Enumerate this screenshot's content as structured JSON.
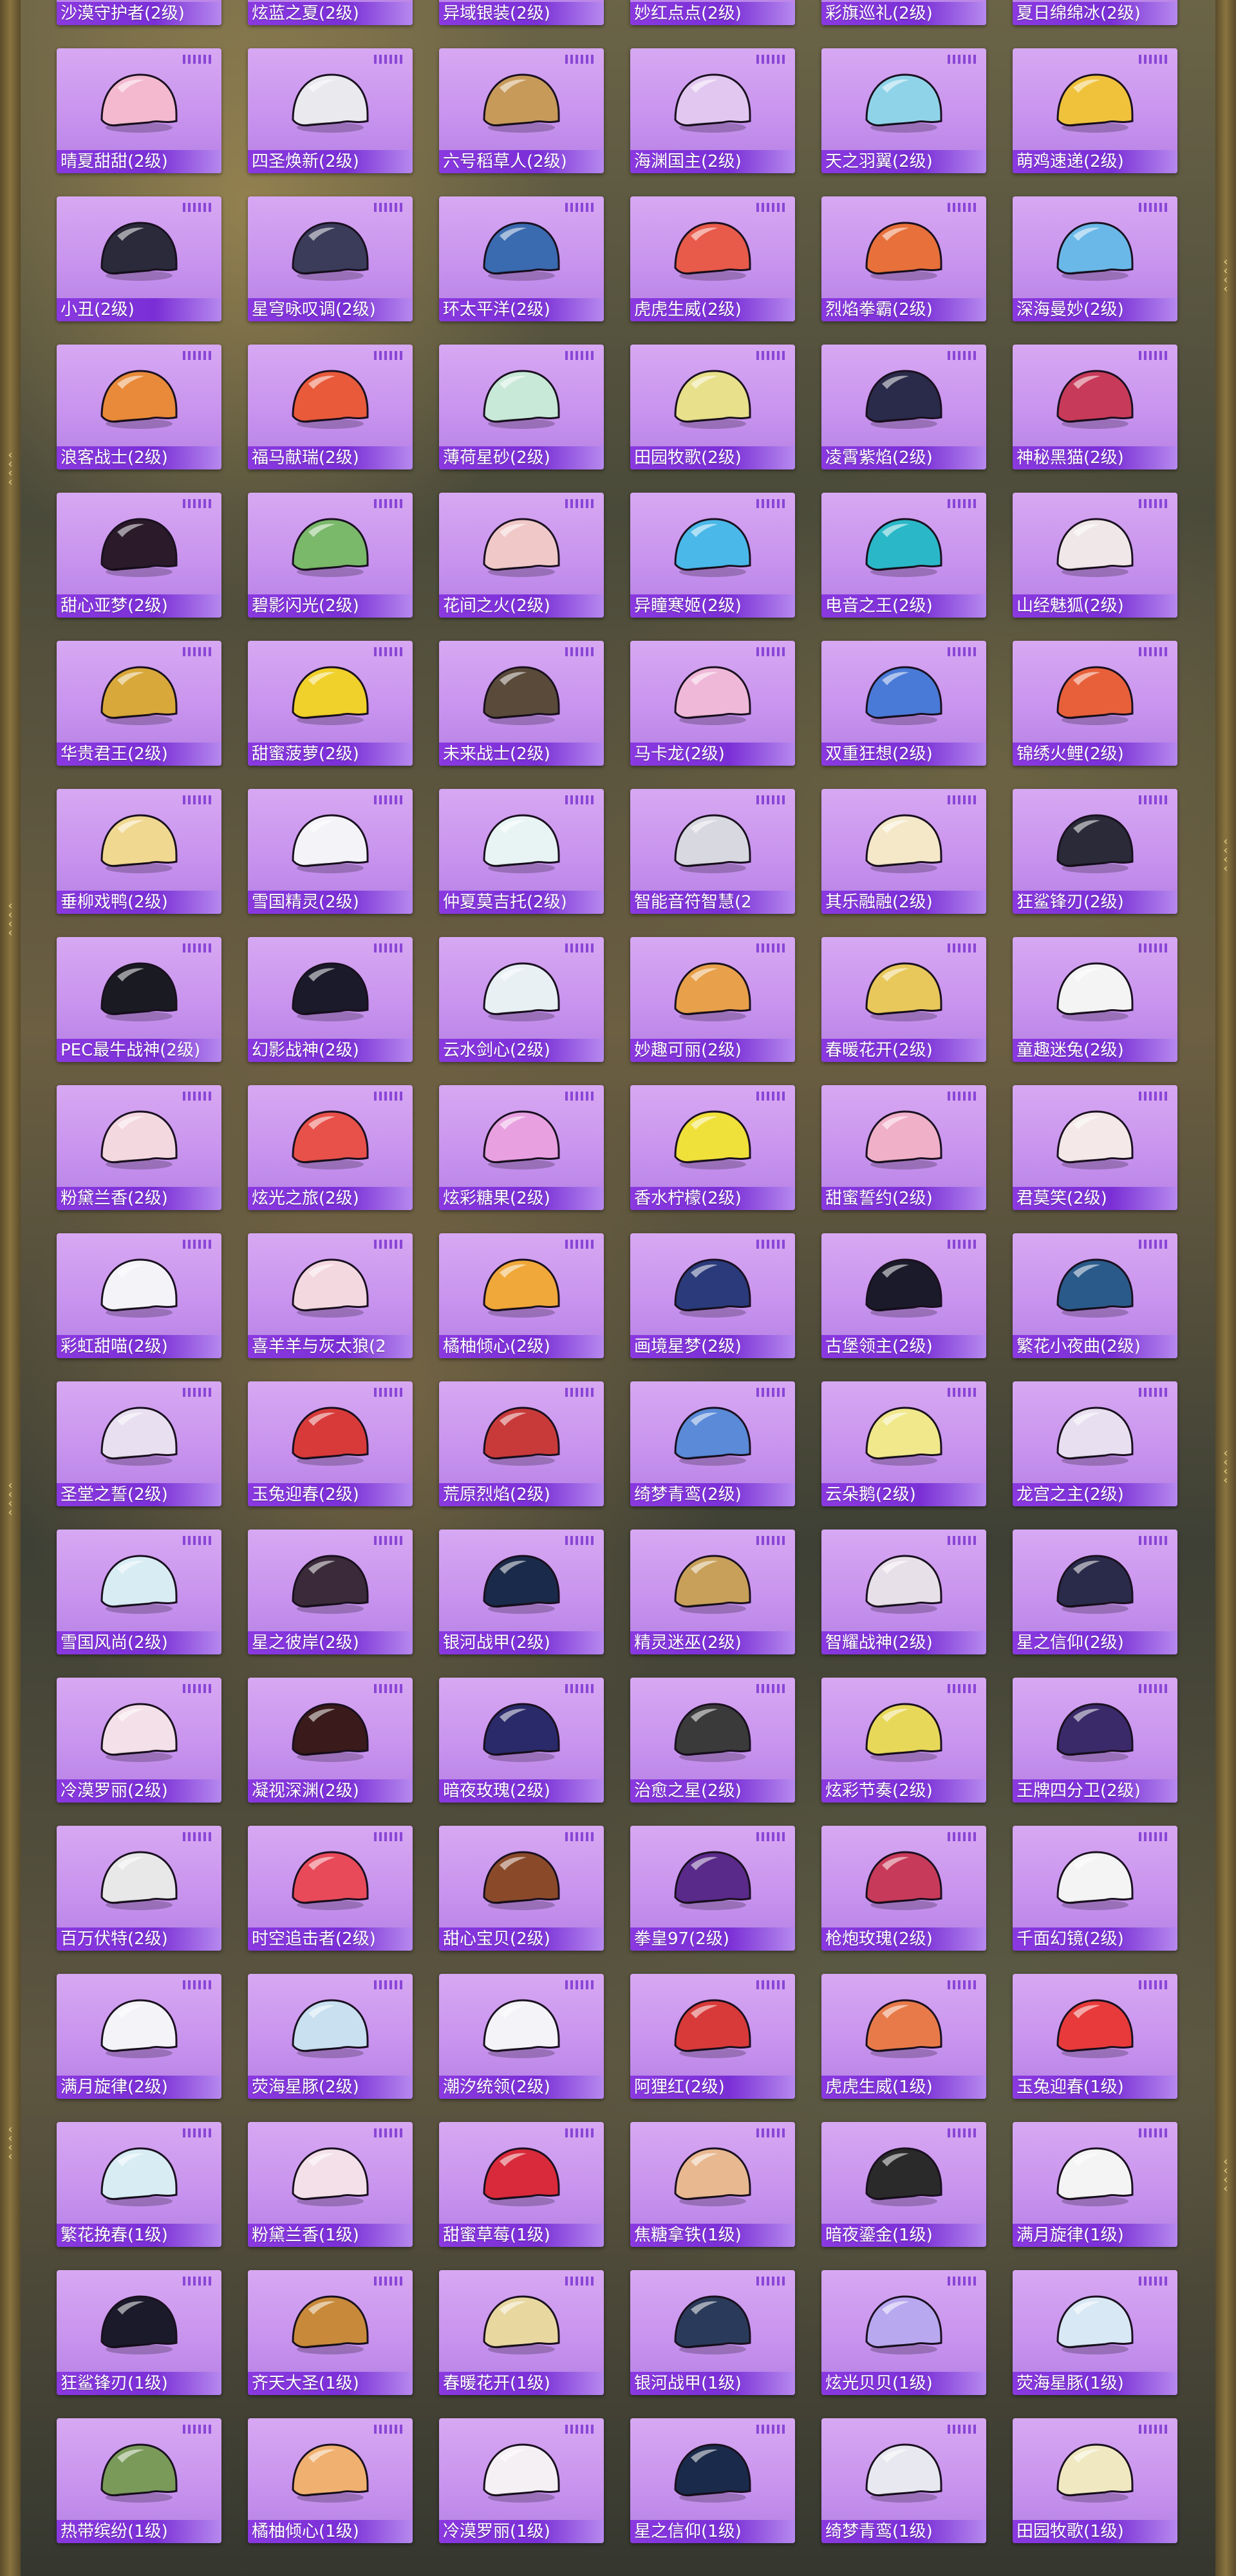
{
  "cards": [
    {
      "label": "沙漠守护者(2级)",
      "color": "#c8a36a",
      "icon": "helmet-icon"
    },
    {
      "label": "炫蓝之夏(2级)",
      "color": "#4a7bd8",
      "icon": "helmet-icon"
    },
    {
      "label": "异域银装(2级)",
      "color": "#c9c9d6",
      "icon": "helmet-icon"
    },
    {
      "label": "妙红点点(2级)",
      "color": "#d84a4a",
      "icon": "helmet-icon"
    },
    {
      "label": "彩旗巡礼(2级)",
      "color": "#e8a64a",
      "icon": "helmet-icon"
    },
    {
      "label": "夏日绵绵冰(2级)",
      "color": "#f2c6e6",
      "icon": "helmet-icon"
    },
    {
      "label": "晴夏甜甜(2级)",
      "color": "#f4b9cf",
      "icon": "helmet-icon"
    },
    {
      "label": "四圣焕新(2级)",
      "color": "#e9e9ee",
      "icon": "helmet-icon"
    },
    {
      "label": "六号稻草人(2级)",
      "color": "#c79a5a",
      "icon": "helmet-icon"
    },
    {
      "label": "海渊国主(2级)",
      "color": "#e2c8f0",
      "icon": "helmet-icon"
    },
    {
      "label": "天之羽翼(2级)",
      "color": "#8fd3e8",
      "icon": "helmet-icon"
    },
    {
      "label": "萌鸡速递(2级)",
      "color": "#f0c23c",
      "icon": "helmet-icon"
    },
    {
      "label": "小丑(2级)",
      "color": "#2a2a3a",
      "icon": "helmet-icon"
    },
    {
      "label": "星穹咏叹调(2级)",
      "color": "#3b3b5a",
      "icon": "helmet-icon"
    },
    {
      "label": "环太平洋(2级)",
      "color": "#3a6ab0",
      "icon": "helmet-icon"
    },
    {
      "label": "虎虎生威(2级)",
      "color": "#e85a4a",
      "icon": "helmet-icon"
    },
    {
      "label": "烈焰拳霸(2级)",
      "color": "#e8703a",
      "icon": "helmet-icon"
    },
    {
      "label": "深海曼妙(2级)",
      "color": "#6ab8e8",
      "icon": "helmet-icon"
    },
    {
      "label": "浪客战士(2级)",
      "color": "#e88a3a",
      "icon": "helmet-icon"
    },
    {
      "label": "福马献瑞(2级)",
      "color": "#e85a3a",
      "icon": "helmet-icon"
    },
    {
      "label": "薄荷星砂(2级)",
      "color": "#c8e8d8",
      "icon": "helmet-icon"
    },
    {
      "label": "田园牧歌(2级)",
      "color": "#e8e08a",
      "icon": "helmet-icon"
    },
    {
      "label": "凌霄紫焰(2级)",
      "color": "#2a2a4a",
      "icon": "helmet-icon"
    },
    {
      "label": "神秘黑猫(2级)",
      "color": "#c83a5a",
      "icon": "helmet-icon"
    },
    {
      "label": "甜心亚梦(2级)",
      "color": "#2a1a2a",
      "icon": "helmet-icon"
    },
    {
      "label": "碧影闪光(2级)",
      "color": "#7ab86a",
      "icon": "helmet-icon"
    },
    {
      "label": "花间之火(2级)",
      "color": "#f0c8c8",
      "icon": "helmet-icon"
    },
    {
      "label": "异瞳寒姬(2级)",
      "color": "#4ab8e8",
      "icon": "helmet-icon"
    },
    {
      "label": "电音之王(2级)",
      "color": "#2ab8c8",
      "icon": "helmet-icon"
    },
    {
      "label": "山经魅狐(2级)",
      "color": "#f0e8e8",
      "icon": "helmet-icon"
    },
    {
      "label": "华贵君王(2级)",
      "color": "#d8a83a",
      "icon": "helmet-icon"
    },
    {
      "label": "甜蜜菠萝(2级)",
      "color": "#f0d02a",
      "icon": "helmet-icon"
    },
    {
      "label": "未来战士(2级)",
      "color": "#5a4a3a",
      "icon": "helmet-icon"
    },
    {
      "label": "马卡龙(2级)",
      "color": "#f0b8d8",
      "icon": "helmet-icon"
    },
    {
      "label": "双重狂想(2级)",
      "color": "#4a7ad8",
      "icon": "helmet-icon"
    },
    {
      "label": "锦绣火鲤(2级)",
      "color": "#e8603a",
      "icon": "helmet-icon"
    },
    {
      "label": "垂柳戏鸭(2级)",
      "color": "#f0d890",
      "icon": "helmet-icon"
    },
    {
      "label": "雪国精灵(2级)",
      "color": "#f4f4f8",
      "icon": "helmet-icon"
    },
    {
      "label": "仲夏莫吉托(2级)",
      "color": "#e8f4f4",
      "icon": "helmet-icon"
    },
    {
      "label": "智能音符智慧(2",
      "color": "#d8d8e0",
      "icon": "helmet-icon"
    },
    {
      "label": "其乐融融(2级)",
      "color": "#f4e8c8",
      "icon": "helmet-icon"
    },
    {
      "label": "狂鲨锋刃(2级)",
      "color": "#2a2a38",
      "icon": "helmet-icon"
    },
    {
      "label": "PEC最牛战神(2级)",
      "color": "#1a1a22",
      "icon": "helmet-icon"
    },
    {
      "label": "幻影战神(2级)",
      "color": "#1a1a2a",
      "icon": "helmet-icon"
    },
    {
      "label": "云水剑心(2级)",
      "color": "#e8f0f4",
      "icon": "helmet-icon"
    },
    {
      "label": "妙趣可丽(2级)",
      "color": "#e8a04a",
      "icon": "helmet-icon"
    },
    {
      "label": "春暖花开(2级)",
      "color": "#e8c85a",
      "icon": "helmet-icon"
    },
    {
      "label": "童趣迷兔(2级)",
      "color": "#f4f4f4",
      "icon": "helmet-icon"
    },
    {
      "label": "粉黛兰香(2级)",
      "color": "#f4d8e0",
      "icon": "helmet-icon"
    },
    {
      "label": "炫光之旅(2级)",
      "color": "#e8504a",
      "icon": "helmet-icon"
    },
    {
      "label": "炫彩糖果(2级)",
      "color": "#e8a0e0",
      "icon": "helmet-icon"
    },
    {
      "label": "香水柠檬(2级)",
      "color": "#f0e03a",
      "icon": "helmet-icon"
    },
    {
      "label": "甜蜜誓约(2级)",
      "color": "#f0b0c8",
      "icon": "helmet-icon"
    },
    {
      "label": "君莫笑(2级)",
      "color": "#f4e8e8",
      "icon": "helmet-icon"
    },
    {
      "label": "彩虹甜喵(2级)",
      "color": "#f4f4f8",
      "icon": "helmet-icon"
    },
    {
      "label": "喜羊羊与灰太狼(2",
      "color": "#f4d8e0",
      "icon": "helmet-icon"
    },
    {
      "label": "橘柚倾心(2级)",
      "color": "#f0a83a",
      "icon": "helmet-icon"
    },
    {
      "label": "画境星梦(2级)",
      "color": "#2a3a7a",
      "icon": "helmet-icon"
    },
    {
      "label": "古堡领主(2级)",
      "color": "#1a1a2a",
      "icon": "helmet-icon"
    },
    {
      "label": "繁花小夜曲(2级)",
      "color": "#2a5a8a",
      "icon": "helmet-icon"
    },
    {
      "label": "圣堂之誓(2级)",
      "color": "#e8e0f0",
      "icon": "helmet-icon"
    },
    {
      "label": "玉兔迎春(2级)",
      "color": "#d83a3a",
      "icon": "helmet-icon"
    },
    {
      "label": "荒原烈焰(2级)",
      "color": "#c83a3a",
      "icon": "helmet-icon"
    },
    {
      "label": "绮梦青鸾(2级)",
      "color": "#5a8ad8",
      "icon": "helmet-icon"
    },
    {
      "label": "云朵鹅(2级)",
      "color": "#f0e88a",
      "icon": "helmet-icon"
    },
    {
      "label": "龙宫之主(2级)",
      "color": "#e8e0f0",
      "icon": "helmet-icon"
    },
    {
      "label": "雪国风尚(2级)",
      "color": "#d8ecf4",
      "icon": "helmet-icon"
    },
    {
      "label": "星之彼岸(2级)",
      "color": "#3a2a3a",
      "icon": "helmet-icon"
    },
    {
      "label": "银河战甲(2级)",
      "color": "#1a2a4a",
      "icon": "helmet-icon"
    },
    {
      "label": "精灵迷巫(2级)",
      "color": "#c8a05a",
      "icon": "helmet-icon"
    },
    {
      "label": "智耀战神(2级)",
      "color": "#e8e0e8",
      "icon": "helmet-icon"
    },
    {
      "label": "星之信仰(2级)",
      "color": "#2a2a4a",
      "icon": "helmet-icon"
    },
    {
      "label": "冷漠罗丽(2级)",
      "color": "#f4e0e8",
      "icon": "helmet-icon"
    },
    {
      "label": "凝视深渊(2级)",
      "color": "#3a1a1a",
      "icon": "helmet-icon"
    },
    {
      "label": "暗夜玫瑰(2级)",
      "color": "#2a2a6a",
      "icon": "helmet-icon"
    },
    {
      "label": "治愈之星(2级)",
      "color": "#3a3a3a",
      "icon": "helmet-icon"
    },
    {
      "label": "炫彩节奏(2级)",
      "color": "#e8d85a",
      "icon": "helmet-icon"
    },
    {
      "label": "王牌四分卫(2级)",
      "color": "#3a2a6a",
      "icon": "helmet-icon"
    },
    {
      "label": "百万伏特(2级)",
      "color": "#e8e8e8",
      "icon": "helmet-icon"
    },
    {
      "label": "时空追击者(2级)",
      "color": "#e84a5a",
      "icon": "helmet-icon"
    },
    {
      "label": "甜心宝贝(2级)",
      "color": "#8a4a2a",
      "icon": "helmet-icon"
    },
    {
      "label": "拳皇97(2级)",
      "color": "#5a2a8a",
      "icon": "helmet-icon"
    },
    {
      "label": "枪炮玫瑰(2级)",
      "color": "#c83a5a",
      "icon": "helmet-icon"
    },
    {
      "label": "千面幻镜(2级)",
      "color": "#f4f4f4",
      "icon": "helmet-icon"
    },
    {
      "label": "满月旋律(2级)",
      "color": "#f4f4f8",
      "icon": "helmet-icon"
    },
    {
      "label": "荧海星豚(2级)",
      "color": "#c8e0f0",
      "icon": "helmet-icon"
    },
    {
      "label": "潮汐统领(2级)",
      "color": "#f4f4f8",
      "icon": "helmet-icon"
    },
    {
      "label": "阿狸红(2级)",
      "color": "#d83a3a",
      "icon": "helmet-icon"
    },
    {
      "label": "虎虎生威(1级)",
      "color": "#e87a4a",
      "icon": "helmet-icon"
    },
    {
      "label": "玉兔迎春(1级)",
      "color": "#e83a3a",
      "icon": "helmet-icon"
    },
    {
      "label": "繁花挽春(1级)",
      "color": "#d8ecf4",
      "icon": "helmet-icon"
    },
    {
      "label": "粉黛兰香(1级)",
      "color": "#f4e0e8",
      "icon": "helmet-icon"
    },
    {
      "label": "甜蜜草莓(1级)",
      "color": "#d82a3a",
      "icon": "helmet-icon"
    },
    {
      "label": "焦糖拿铁(1级)",
      "color": "#e8b890",
      "icon": "helmet-icon"
    },
    {
      "label": "暗夜鎏金(1级)",
      "color": "#2a2a2a",
      "icon": "helmet-icon"
    },
    {
      "label": "满月旋律(1级)",
      "color": "#f4f4f4",
      "icon": "helmet-icon"
    },
    {
      "label": "狂鲨锋刃(1级)",
      "color": "#1a1a2a",
      "icon": "helmet-icon"
    },
    {
      "label": "齐天大圣(1级)",
      "color": "#c88a3a",
      "icon": "helmet-icon"
    },
    {
      "label": "春暖花开(1级)",
      "color": "#e8d8a0",
      "icon": "helmet-icon"
    },
    {
      "label": "银河战甲(1级)",
      "color": "#2a3a5a",
      "icon": "helmet-icon"
    },
    {
      "label": "炫光贝贝(1级)",
      "color": "#b8a8f0",
      "icon": "helmet-icon"
    },
    {
      "label": "荧海星豚(1级)",
      "color": "#d8e8f4",
      "icon": "helmet-icon"
    },
    {
      "label": "热带缤纷(1级)",
      "color": "#7a9a5a",
      "icon": "helmet-icon"
    },
    {
      "label": "橘柚倾心(1级)",
      "color": "#f0b070",
      "icon": "helmet-icon"
    },
    {
      "label": "冷漠罗丽(1级)",
      "color": "#f4f0f4",
      "icon": "helmet-icon"
    },
    {
      "label": "星之信仰(1级)",
      "color": "#1a2a4a",
      "icon": "helmet-icon"
    },
    {
      "label": "绮梦青鸾(1级)",
      "color": "#e8e8f0",
      "icon": "helmet-icon"
    },
    {
      "label": "田园牧歌(1级)",
      "color": "#f0e8c0",
      "icon": "helmet-icon"
    }
  ]
}
